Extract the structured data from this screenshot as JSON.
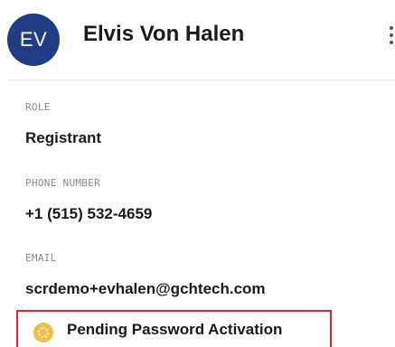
{
  "profile": {
    "initials": "EV",
    "name": "Elvis Von Halen"
  },
  "fields": {
    "role": {
      "label": "ROLE",
      "value": "Registrant"
    },
    "phone": {
      "label": "PHONE NUMBER",
      "value": "+1 (515) 532-4659"
    },
    "email": {
      "label": "EMAIL",
      "value": "scrdemo+evhalen@gchtech.com"
    }
  },
  "status": {
    "text": "Pending Password Activation",
    "icon": "pending-circle-icon",
    "color": "#e8c24a"
  },
  "colors": {
    "avatar_bg": "#1f3c84",
    "highlight_border": "#e0252f"
  }
}
